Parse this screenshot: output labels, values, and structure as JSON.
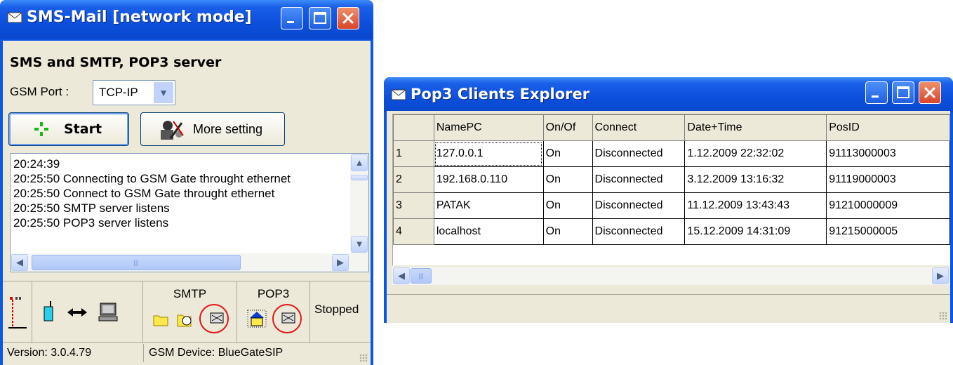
{
  "sms_window": {
    "title": "SMS-Mail  [network mode]",
    "heading": "SMS and SMTP, POP3 server",
    "gsm_port_label": "GSM Port :",
    "gsm_port_value": "TCP-IP",
    "start_label": "Start",
    "more_label": "More setting",
    "log": [
      "20:24:39",
      "20:25:50  Connecting to GSM Gate throught ethernet",
      "20:25:50  Connect to GSM Gate throught ethernet",
      "20:25:50  SMTP server listens",
      "20:25:50  POP3 server listens"
    ],
    "smtp_label": "SMTP",
    "pop3_label": "POP3",
    "state_label": "Stopped",
    "version": "Version: 3.0.4.79",
    "device": "GSM Device: BlueGateSIP"
  },
  "pop3_window": {
    "title": "Pop3 Clients Explorer",
    "columns": [
      "NamePC",
      "On/Of",
      "Connect",
      "Date+Time",
      "PosID"
    ],
    "rows": [
      {
        "n": "1",
        "name": "127.0.0.1",
        "on": "On",
        "connect": "Disconnected",
        "datetime": "1.12.2009 22:32:02",
        "posid": "91113000003"
      },
      {
        "n": "2",
        "name": "192.168.0.110",
        "on": "On",
        "connect": "Disconnected",
        "datetime": "3.12.2009 13:16:32",
        "posid": "91119000003"
      },
      {
        "n": "3",
        "name": "PATAK",
        "on": "On",
        "connect": "Disconnected",
        "datetime": "11.12.2009 13:43:43",
        "posid": "91210000009"
      },
      {
        "n": "4",
        "name": "localhost",
        "on": "On",
        "connect": "Disconnected",
        "datetime": "15.12.2009 14:31:09",
        "posid": "91215000005"
      }
    ]
  },
  "colors": {
    "title_blue": "#0a56e6",
    "face": "#ece9d8",
    "highlight_circle": "#e01818",
    "close_red": "#d8442a"
  },
  "icons": [
    "envelope-icon",
    "minimize-icon",
    "maximize-icon",
    "close-icon",
    "start-icon",
    "settings-icon",
    "signal-icon",
    "phone-icon",
    "link-icon",
    "computer-icon",
    "folder-icon",
    "log-icon",
    "network-icon",
    "home-icon"
  ]
}
